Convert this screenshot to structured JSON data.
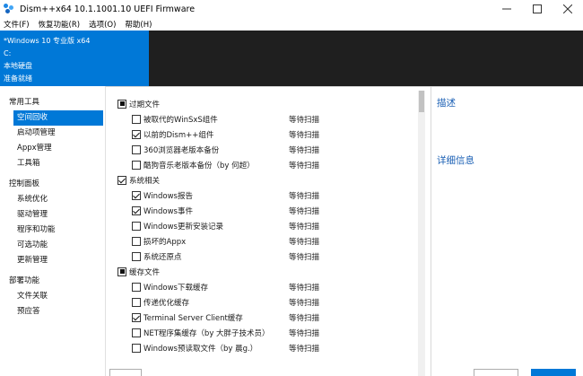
{
  "window": {
    "title": "Dism++x64 10.1.1001.10 UEFI Firmware",
    "buttons": [
      "minimize",
      "maximize",
      "close"
    ]
  },
  "menu": [
    "文件(F)",
    "恢复功能(R)",
    "选项(O)",
    "帮助(H)"
  ],
  "banner": {
    "os": "*Windows 10 专业版 x64",
    "drive": "C:",
    "disk": "本地硬盘",
    "status": "准备就绪"
  },
  "nav": {
    "groups": [
      {
        "label": "常用工具",
        "items": [
          "空间回收",
          "启动项管理",
          "Appx管理",
          "工具箱"
        ]
      },
      {
        "label": "控制面板",
        "items": [
          "系统优化",
          "驱动管理",
          "程序和功能",
          "可选功能",
          "更新管理"
        ]
      },
      {
        "label": "部署功能",
        "items": [
          "文件关联",
          "预应答"
        ]
      }
    ],
    "active": "空间回收"
  },
  "list": [
    {
      "type": "group",
      "label": "过期文件",
      "state": "partial"
    },
    {
      "type": "child",
      "label": "被取代的WinSxS组件",
      "status": "等待扫描",
      "checked": false
    },
    {
      "type": "child",
      "label": "以前的Dism++组件",
      "status": "等待扫描",
      "checked": true
    },
    {
      "type": "child",
      "label": "360浏览器老版本备份",
      "status": "等待扫描",
      "checked": false
    },
    {
      "type": "child",
      "label": "酷狗音乐老版本备份（by 何超）",
      "status": "等待扫描",
      "checked": false
    },
    {
      "type": "group",
      "label": "系统相关",
      "state": "checked"
    },
    {
      "type": "child",
      "label": "Windows报告",
      "status": "等待扫描",
      "checked": true
    },
    {
      "type": "child",
      "label": "Windows事件",
      "status": "等待扫描",
      "checked": true
    },
    {
      "type": "child",
      "label": "Windows更新安装记录",
      "status": "等待扫描",
      "checked": false
    },
    {
      "type": "child",
      "label": "损坏的Appx",
      "status": "等待扫描",
      "checked": false
    },
    {
      "type": "child",
      "label": "系统还原点",
      "status": "等待扫描",
      "checked": false
    },
    {
      "type": "group",
      "label": "缓存文件",
      "state": "partial"
    },
    {
      "type": "child",
      "label": "Windows下载缓存",
      "status": "等待扫描",
      "checked": false
    },
    {
      "type": "child",
      "label": "传递优化缓存",
      "status": "等待扫描",
      "checked": false
    },
    {
      "type": "child",
      "label": "Terminal Server Client缓存",
      "status": "等待扫描",
      "checked": true
    },
    {
      "type": "child",
      "label": "NET程序集缓存（by 大胖子技术员）",
      "status": "等待扫描",
      "checked": false
    },
    {
      "type": "child",
      "label": "Windows预读取文件（by 晨g.）",
      "status": "等待扫描",
      "checked": false
    }
  ],
  "right": {
    "description_title": "描述",
    "details_title": "详细信息"
  },
  "colors": {
    "accent": "#0078d7",
    "dark_banner": "#1f1f1f",
    "pane_title": "#1a5fb4"
  }
}
